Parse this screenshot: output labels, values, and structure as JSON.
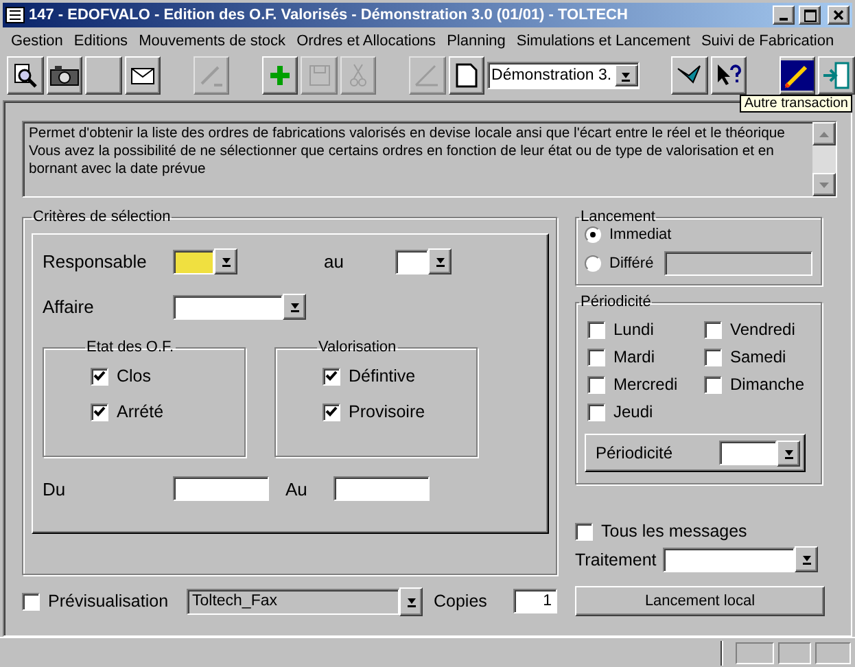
{
  "window": {
    "title": "147 - EDOFVALO - Edition des O.F. Valorisés - Démonstration 3.0 (01/01) - TOLTECH"
  },
  "menu": [
    "Gestion",
    "Editions",
    "Mouvements de stock",
    "Ordres et Allocations",
    "Planning",
    "Simulations et Lancement",
    "Suivi de Fabrication"
  ],
  "toolbar": [
    {
      "kind": "button",
      "disabled": false
    },
    {
      "kind": "button",
      "disabled": false
    },
    {
      "kind": "button",
      "disabled": false
    },
    {
      "kind": "button",
      "disabled": false
    },
    {
      "kind": "separator"
    },
    {
      "kind": "button",
      "disabled": true
    },
    {
      "kind": "separator"
    },
    {
      "kind": "button",
      "disabled": false
    },
    {
      "kind": "button",
      "disabled": true
    },
    {
      "kind": "button",
      "disabled": true
    },
    {
      "kind": "separator"
    },
    {
      "kind": "button",
      "disabled": true
    },
    {
      "kind": "button",
      "disabled": false
    },
    {
      "kind": "combo",
      "value": "Démonstration 3."
    },
    {
      "kind": "separator"
    },
    {
      "kind": "button",
      "disabled": false
    },
    {
      "kind": "button",
      "disabled": false
    },
    {
      "kind": "separator"
    },
    {
      "kind": "button",
      "disabled": false
    },
    {
      "kind": "button",
      "disabled": false
    }
  ],
  "tooltip": "Autre transaction",
  "description": "Permet d'obtenir la liste des ordres de fabrications valorisés en devise locale ansi que l'écart entre le réel et le théorique  Vous avez la possibilité de ne sélectionner que certains ordres en fonction de leur état ou de type de valorisation et en bornant avec la date prévue",
  "criteria": {
    "title": "Critères de sélection",
    "responsable": {
      "label": "Responsable",
      "highlighted": true
    },
    "responsable_to": {
      "label": "au",
      "highlighted": false
    },
    "affaire": {
      "label": "Affaire"
    },
    "groups": [
      {
        "title": "Etat des O.F.",
        "options": [
          {
            "label": "Clos",
            "checked": true
          },
          {
            "label": "Arrété",
            "checked": true
          }
        ]
      },
      {
        "title": "Valorisation",
        "options": [
          {
            "label": "Défintive",
            "checked": true
          },
          {
            "label": "Provisoire",
            "checked": true
          }
        ]
      }
    ],
    "date_from": {
      "label": "Du"
    },
    "date_to": {
      "label": "Au"
    }
  },
  "lancement": {
    "title": "Lancement",
    "options": [
      {
        "label": "Immediat",
        "selected": true
      },
      {
        "label": "Différé",
        "selected": false
      }
    ]
  },
  "periodicite": {
    "title": "Périodicité",
    "days": [
      {
        "label": "Lundi",
        "checked": false
      },
      {
        "label": "Mardi",
        "checked": false
      },
      {
        "label": "Mercredi",
        "checked": false
      },
      {
        "label": "Jeudi",
        "checked": false
      },
      {
        "label": "Vendredi",
        "checked": false
      },
      {
        "label": "Samedi",
        "checked": false
      },
      {
        "label": "Dimanche",
        "checked": false
      }
    ],
    "field_label": "Périodicité"
  },
  "all_messages": {
    "label": "Tous les messages",
    "checked": false
  },
  "traitement": {
    "label": "Traitement"
  },
  "launch_button": "Lancement local",
  "preview": {
    "label": "Prévisualisation",
    "checked": false
  },
  "printer": {
    "value": "Toltech_Fax"
  },
  "copies": {
    "label": "Copies",
    "value": "1"
  }
}
